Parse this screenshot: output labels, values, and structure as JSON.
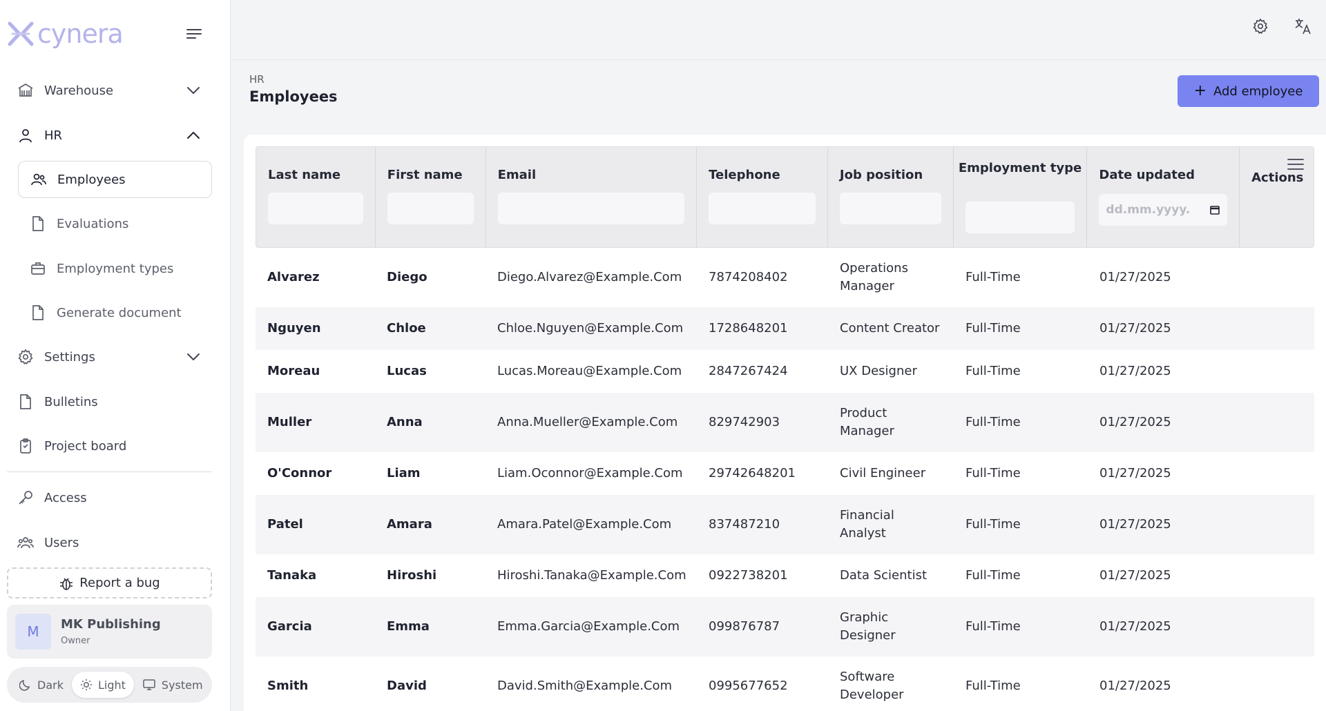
{
  "app": {
    "logo_text": "cynera"
  },
  "sidebar": {
    "warehouse": "Warehouse",
    "hr": "HR",
    "hr_items": [
      "Employees",
      "Evaluations",
      "Employment types",
      "Generate document"
    ],
    "settings": "Settings",
    "bulletins": "Bulletins",
    "project_board": "Project board",
    "access": "Access",
    "users": "Users",
    "report_bug": "Report a bug",
    "org": {
      "initial": "M",
      "name": "MK Publishing",
      "role": "Owner"
    },
    "theme": {
      "dark": "Dark",
      "light": "Light",
      "system": "System",
      "selected": "Light"
    }
  },
  "header": {
    "breadcrumb": "HR",
    "title": "Employees",
    "add_button": "Add employee"
  },
  "table": {
    "columns": {
      "last_name": "Last name",
      "first_name": "First name",
      "email": "Email",
      "telephone": "Telephone",
      "job_position": "Job position",
      "employment_type": "Employment type",
      "date_updated": "Date updated",
      "actions": "Actions"
    },
    "date_placeholder": "dd.mm.yyyy.",
    "rows": [
      [
        "Alvarez",
        "Diego",
        "Diego.Alvarez@Example.Com",
        "7874208402",
        "Operations Manager",
        "Full-Time",
        "01/27/2025"
      ],
      [
        "Nguyen",
        "Chloe",
        "Chloe.Nguyen@Example.Com",
        "1728648201",
        "Content Creator",
        "Full-Time",
        "01/27/2025"
      ],
      [
        "Moreau",
        "Lucas",
        "Lucas.Moreau@Example.Com",
        "2847267424",
        "UX Designer",
        "Full-Time",
        "01/27/2025"
      ],
      [
        "Muller",
        "Anna",
        "Anna.Mueller@Example.Com",
        "829742903",
        "Product Manager",
        "Full-Time",
        "01/27/2025"
      ],
      [
        "O'Connor",
        "Liam",
        "Liam.Oconnor@Example.Com",
        "29742648201",
        "Civil Engineer",
        "Full-Time",
        "01/27/2025"
      ],
      [
        "Patel",
        "Amara",
        "Amara.Patel@Example.Com",
        "837487210",
        "Financial Analyst",
        "Full-Time",
        "01/27/2025"
      ],
      [
        "Tanaka",
        "Hiroshi",
        "Hiroshi.Tanaka@Example.Com",
        "0922738201",
        "Data Scientist",
        "Full-Time",
        "01/27/2025"
      ],
      [
        "Garcia",
        "Emma",
        "Emma.Garcia@Example.Com",
        "099876787",
        "Graphic Designer",
        "Full-Time",
        "01/27/2025"
      ],
      [
        "Smith",
        "David",
        "David.Smith@Example.Com",
        "0995677652",
        "Software Developer",
        "Full-Time",
        "01/27/2025"
      ]
    ]
  },
  "colors": {
    "accent": "#7a84f0",
    "logo": "#b4b3ea"
  }
}
